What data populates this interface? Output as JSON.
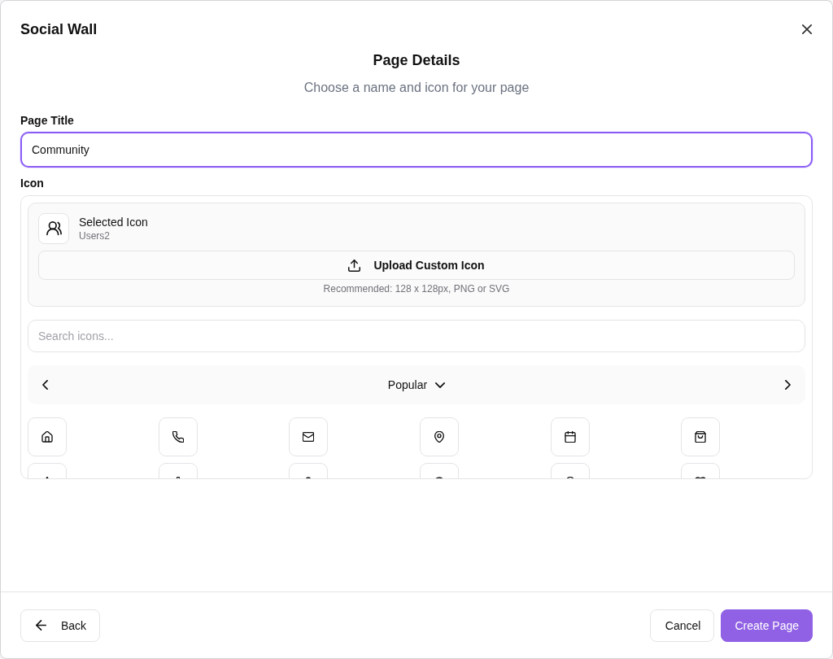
{
  "dialog": {
    "title": "Social Wall"
  },
  "step": {
    "title": "Page Details",
    "subtitle": "Choose a name and icon for your page"
  },
  "page_title": {
    "label": "Page Title",
    "value": "Community",
    "focused": true
  },
  "icon": {
    "label": "Icon",
    "selected_heading": "Selected Icon",
    "selected_name": "Users2",
    "upload_button": "Upload Custom Icon",
    "recommendation": "Recommended: 128 x 128px, PNG or SVG",
    "search": {
      "placeholder": "Search icons..."
    },
    "category": "Popular",
    "options": [
      {
        "selected": false
      },
      {
        "selected": false
      },
      {
        "selected": false
      },
      {
        "selected": false
      },
      {
        "selected": false
      },
      {
        "selected": false
      },
      {
        "selected": false
      },
      {
        "selected": false
      },
      {
        "selected": false
      },
      {
        "selected": false
      },
      {
        "selected": false
      },
      {
        "selected": false
      }
    ]
  },
  "footer": {
    "back": "Back",
    "cancel": "Cancel",
    "create": "Create Page"
  }
}
